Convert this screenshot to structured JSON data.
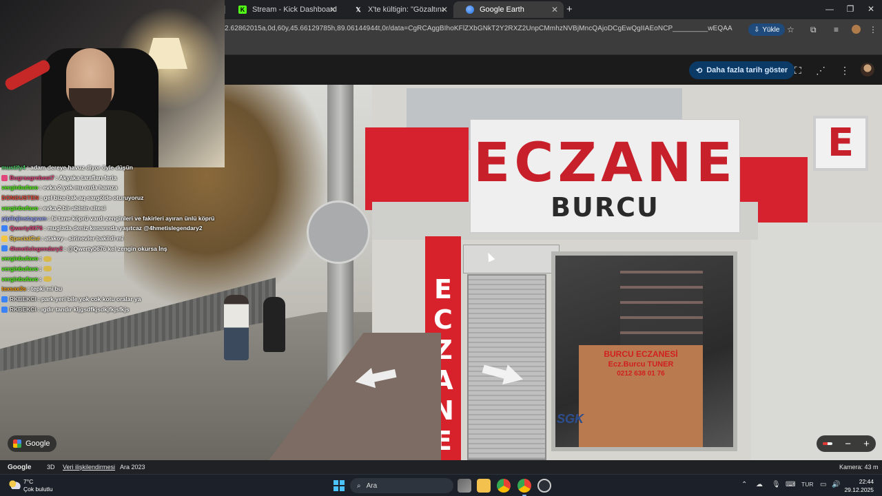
{
  "browser": {
    "tabs": [
      {
        "label": "Stream - Kick Dashboard",
        "icon": "kick-icon",
        "active": false
      },
      {
        "label": "X'te kültigin: \"Gözaltına alınan",
        "icon": "x-icon",
        "active": false
      },
      {
        "label": "Google Earth",
        "icon": "google-earth-icon",
        "active": true
      }
    ],
    "new_tab": "+",
    "url": "2.62862015a,0d,60y,45.66129785h,89.06144944t,0r/data=CgRCAggBIhoKFlZXbGNkT2Y2RXZ2UnpCMmhzNVBjMncQAjoDCgEwQgIIAEoNCP_________wEQAA",
    "install_label": "Yükle"
  },
  "earth": {
    "history_button": "Daha fazla tarih göster",
    "footer": {
      "brand": "Google",
      "ratio": "3D",
      "data_attribution": "Veri ilişkilendirmesi",
      "date": "Ara 2023",
      "camera": "Kamera: 43 m"
    },
    "google_chip": "Google",
    "zoom_minus": "−",
    "zoom_plus": "+"
  },
  "scene": {
    "sign_main": "ECZANE",
    "sign_sub": "BURCU",
    "vertical_sign": "E\nC\nZ\nA\nN\nE",
    "poster_line1": "BURCU ECZANESİ",
    "poster_line2": "Ecz.Burcu TUNER",
    "poster_line3": "0212 638 01 76",
    "sgk": "SGK",
    "right_sign": "E"
  },
  "chat": {
    "messages": [
      {
        "user": "mustify4",
        "text": ": adam dereye havuz diyor öyle düşün",
        "color": "#4fcf6a"
      },
      {
        "user": "Bugraagrebest7",
        "text": ": Akyaka tarafları feria",
        "color": "#e0457b",
        "badge": "#e0457b"
      },
      {
        "user": "verginbufavo",
        "text": ": evka 2 yok mu orda hamza",
        "color": "#53fc18"
      },
      {
        "user": "DONGUSTEN",
        "text": ": gel bize bak aq sargölde oturuyoruz",
        "color": "#e84a3a"
      },
      {
        "user": "verginbufavo",
        "text": ": evka 2 bir abinin sitesi",
        "color": "#53fc18"
      },
      {
        "user": "pipilojinstagram",
        "text": ": bi tane köprü vardı zenginleri ve fakirleri ayıran ünlü köprü",
        "color": "#9aa6ff"
      },
      {
        "user": "Qwerty0676",
        "text": ": muglada deniz kenarında yaşıtcaz @4hmetislegendary2",
        "color": "#e0457b",
        "badge": "#3b82f6"
      },
      {
        "user": "SpecialCut",
        "text": ": atakoy - sirinevler bakildi mi",
        "color": "#f5c542",
        "badge": "#f5c542"
      },
      {
        "user": "4hmetislegendary2",
        "text": ": @Qwerty0676 kel zengin okursa İnş",
        "color": "#e0457b",
        "badge": "#3b82f6"
      },
      {
        "user": "verginbufavo",
        "text": ":",
        "color": "#53fc18",
        "emote": true
      },
      {
        "user": "verginbufavo",
        "text": ":",
        "color": "#53fc18",
        "emote": true
      },
      {
        "user": "verginbufavo",
        "text": ":",
        "color": "#53fc18",
        "emote": true
      },
      {
        "user": "texsax3s",
        "text": ": tepki mi bu",
        "color": "#f59e0b"
      },
      {
        "user": "RKBEKCI",
        "text": ": park yeri bile yok cok kotu oralar ya",
        "color": "#dddddd",
        "badge": "#3b82f6"
      },
      {
        "user": "RKBEKCI",
        "text": ": ıgdır tandır kljgsdfkjsdkjfkjsfkjs",
        "color": "#dddddd",
        "badge": "#3b82f6"
      }
    ]
  },
  "taskbar": {
    "weather_temp": "7°C",
    "weather_desc": "Çok bulutlu",
    "search_label": "Ara",
    "lang": "TUR",
    "time": "22:44",
    "date": "29.12.2025"
  }
}
